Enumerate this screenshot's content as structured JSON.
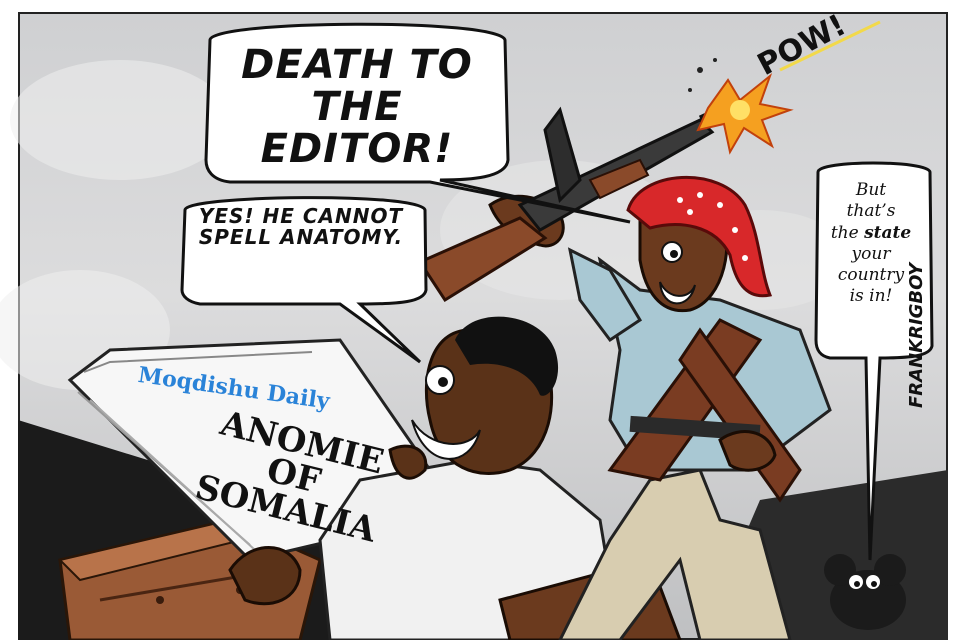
{
  "cartoon": {
    "speech_bubble_1": "DEATH TO THE EDITOR!",
    "speech_bubble_2": "YES! HE CANNOT SPELL ANATOMY.",
    "speech_bubble_3_line1": "But",
    "speech_bubble_3_line2": "that’s",
    "speech_bubble_3_line3_pre": "the",
    "speech_bubble_3_line3_bold": "state",
    "speech_bubble_3_line4": "your",
    "speech_bubble_3_line5": "country",
    "speech_bubble_3_line6": "is in!",
    "sound_effect": "POW!",
    "newspaper_name": "Moqdishu Daily",
    "newspaper_headline_line1": "ANOMIE",
    "newspaper_headline_line2": "OF",
    "newspaper_headline_line3": "SOMALIA",
    "artist_signature": "FRANKRIGBOY"
  },
  "colors": {
    "sky": "#d6d6d8",
    "newspaper_brand": "#2a83d8",
    "headscarf": "#d8282a",
    "shirt_militant": "#a9c8d3",
    "gun_wood": "#8a4a2a",
    "muzzle_flash": "#f5a020"
  }
}
